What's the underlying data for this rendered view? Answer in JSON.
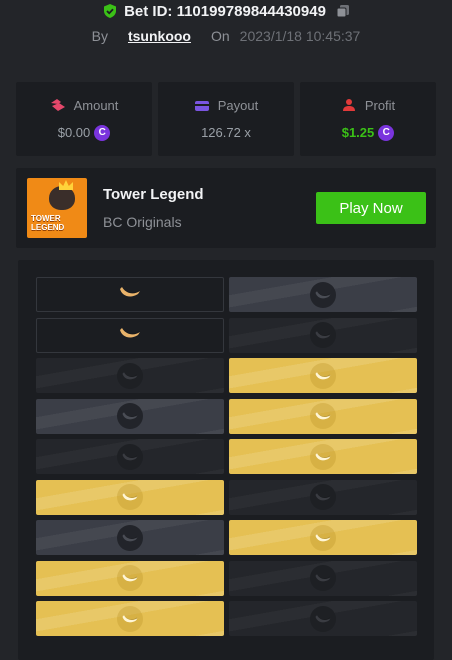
{
  "header": {
    "bet_id": "Bet ID: 110199789844430949",
    "by_label": "By",
    "user": "tsunkooo",
    "on_label": "On",
    "date": "2023/1/18 10:45:37"
  },
  "stats": [
    {
      "label": "Amount",
      "value": "$0.00",
      "coin": "C",
      "color": "#e5486b"
    },
    {
      "label": "Payout",
      "value": "126.72 x",
      "color": "#7a55e0"
    },
    {
      "label": "Profit",
      "value": "$1.25",
      "coin": "C",
      "color": "#e23a3a"
    }
  ],
  "game": {
    "name": "Tower Legend",
    "provider": "BC Originals",
    "thumb_text_1": "TOWER",
    "thumb_text_2": "LEGEND",
    "play_label": "Play Now"
  },
  "board": {
    "rows": [
      [
        "plain-banana",
        "slate"
      ],
      [
        "plain-banana",
        "dark"
      ],
      [
        "dark",
        "gold"
      ],
      [
        "slate",
        "gold"
      ],
      [
        "dark",
        "gold"
      ],
      [
        "gold",
        "dark"
      ],
      [
        "slate",
        "gold"
      ],
      [
        "gold",
        "dark"
      ],
      [
        "gold",
        "dark"
      ]
    ]
  },
  "colors": {
    "accent_green": "#3bc117",
    "tile_gold": "#e5c053"
  }
}
